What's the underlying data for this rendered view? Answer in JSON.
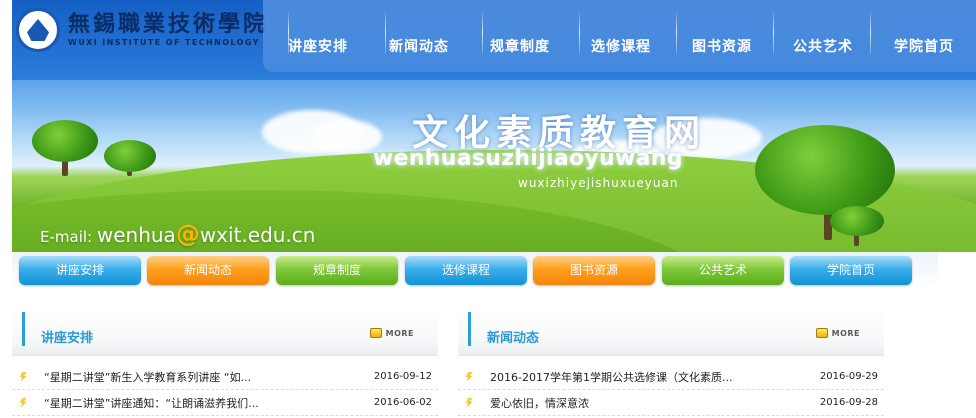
{
  "header": {
    "logo_cn": "無錫職業技術學院",
    "logo_en": "WUXI INSTITUTE OF TECHNOLOGY",
    "site_title": "文化素质教育网",
    "site_pinyin": "wenhuasuzhijiaoyuwang",
    "site_subtitle": "wuxizhiyejishuxueyuan",
    "email_label": "E-mail: ",
    "email_user": "wenhua",
    "email_at": "@",
    "email_domain": "wxit.edu.cn"
  },
  "top_nav": [
    {
      "label": "讲座安排"
    },
    {
      "label": "新闻动态"
    },
    {
      "label": "规章制度"
    },
    {
      "label": "选修课程"
    },
    {
      "label": "图书资源"
    },
    {
      "label": "公共艺术"
    },
    {
      "label": "学院首页"
    }
  ],
  "menu_bar": [
    {
      "label": "讲座安排",
      "color": "#1192d7"
    },
    {
      "label": "新闻动态",
      "color": "#f4850b"
    },
    {
      "label": "规章制度",
      "color": "#5aad1c"
    },
    {
      "label": "选修课程",
      "color": "#1192d7"
    },
    {
      "label": "图书资源",
      "color": "#f4850b"
    },
    {
      "label": "公共艺术",
      "color": "#5aad1c"
    },
    {
      "label": "学院首页",
      "color": "#1192d7"
    }
  ],
  "panels": {
    "lectures": {
      "title": "讲座安排",
      "more": "MORE",
      "items": [
        {
          "title": "“星期二讲堂”新生入学教育系列讲座 “如...",
          "date": "2016-09-12"
        },
        {
          "title": "“星期二讲堂”讲座通知：“让朗诵滋养我们...",
          "date": "2016-06-02"
        }
      ]
    },
    "news": {
      "title": "新闻动态",
      "more": "MORE",
      "items": [
        {
          "title": "2016-2017学年第1学期公共选修课（文化素质...",
          "date": "2016-09-29"
        },
        {
          "title": "爱心依旧，情深意浓",
          "date": "2016-09-28"
        }
      ]
    }
  },
  "colors": {
    "accent": "#2a9bd4",
    "nav_blue": "#1192d7",
    "nav_orange": "#f4850b",
    "nav_green": "#5aad1c"
  }
}
